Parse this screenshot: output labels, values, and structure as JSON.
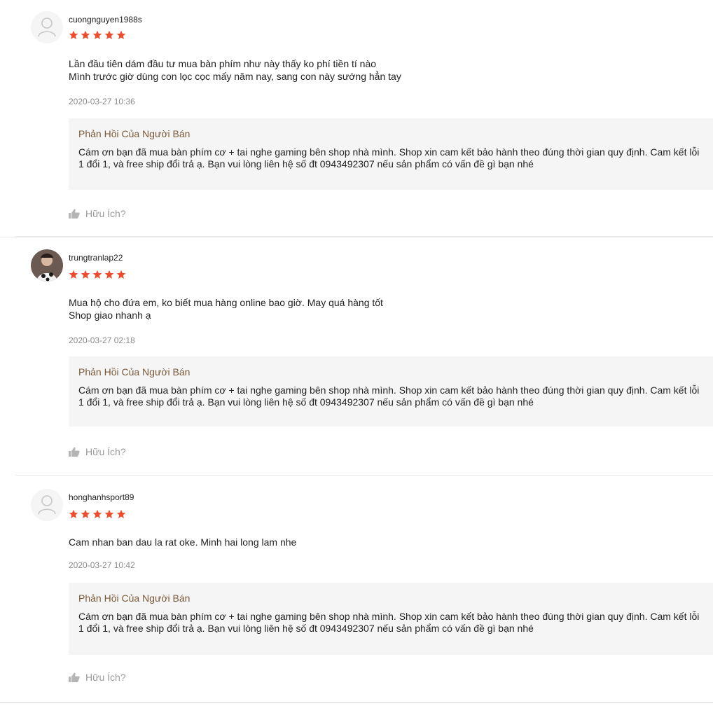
{
  "reviews": [
    {
      "username": "cuongnguyen1988s",
      "rating": 5,
      "avatar": "default-user-icon",
      "comment": [
        "Lần đầu tiên dám đầu tư mua bàn phím như này thấy ko phí tiền tí nào",
        "Mình trước giờ dùng con lọc cọc mấy năm nay, sang con này sướng hẳn tay"
      ],
      "time": "2020-03-27 10:36",
      "reply_title": "Phản Hồi Của Người Bán",
      "reply_text": "Cám ơn bạn đã mua bàn phím cơ + tai nghe gaming bên shop nhà mình. Shop xin cam kết bảo hành theo đúng thời gian quy định. Cam kết lỗi 1 đổi 1, và free ship đổi trả ạ. Bạn vui lòng liên hệ số đt 0943492307 nếu sản phẩm có vấn đề gì bạn nhé",
      "helpful_label": "Hữu Ích?"
    },
    {
      "username": "trungtranlap22",
      "rating": 5,
      "avatar": "user-photo",
      "comment": [
        "Mua hộ cho đứa em, ko biết mua hàng online bao giờ. May quá hàng tốt",
        "Shop giao nhanh ạ"
      ],
      "time": "2020-03-27 02:18",
      "reply_title": "Phản Hồi Của Người Bán",
      "reply_text": "Cám ơn bạn đã mua bàn phím cơ + tai nghe gaming bên shop nhà mình. Shop xin cam kết bảo hành theo đúng thời gian quy định. Cam kết lỗi 1 đổi 1, và free ship đổi trả ạ. Bạn vui lòng liên hệ số đt 0943492307 nếu sản phẩm có vấn đề gì bạn nhé",
      "helpful_label": "Hữu Ích?"
    },
    {
      "username": "honghanhsport89",
      "rating": 5,
      "avatar": "default-user-icon",
      "comment": [
        "Cam nhan ban dau la rat oke. Minh hai long lam nhe"
      ],
      "time": "2020-03-27 10:42",
      "reply_title": "Phản Hồi Của Người Bán",
      "reply_text": "Cám ơn bạn đã mua bàn phím cơ + tai nghe gaming bên shop nhà mình. Shop xin cam kết bảo hành theo đúng thời gian quy định. Cam kết lỗi 1 đổi 1, và free ship đổi trả ạ. Bạn vui lòng liên hệ số đt 0943492307 nếu sản phẩm có vấn đề gì bạn nhé",
      "helpful_label": "Hữu Ích?"
    }
  ],
  "colors": {
    "star": "#ee4d2d",
    "reply_title": "#7a5a3a",
    "reply_bg": "#f5f5f5",
    "muted": "#8a8a8a"
  }
}
